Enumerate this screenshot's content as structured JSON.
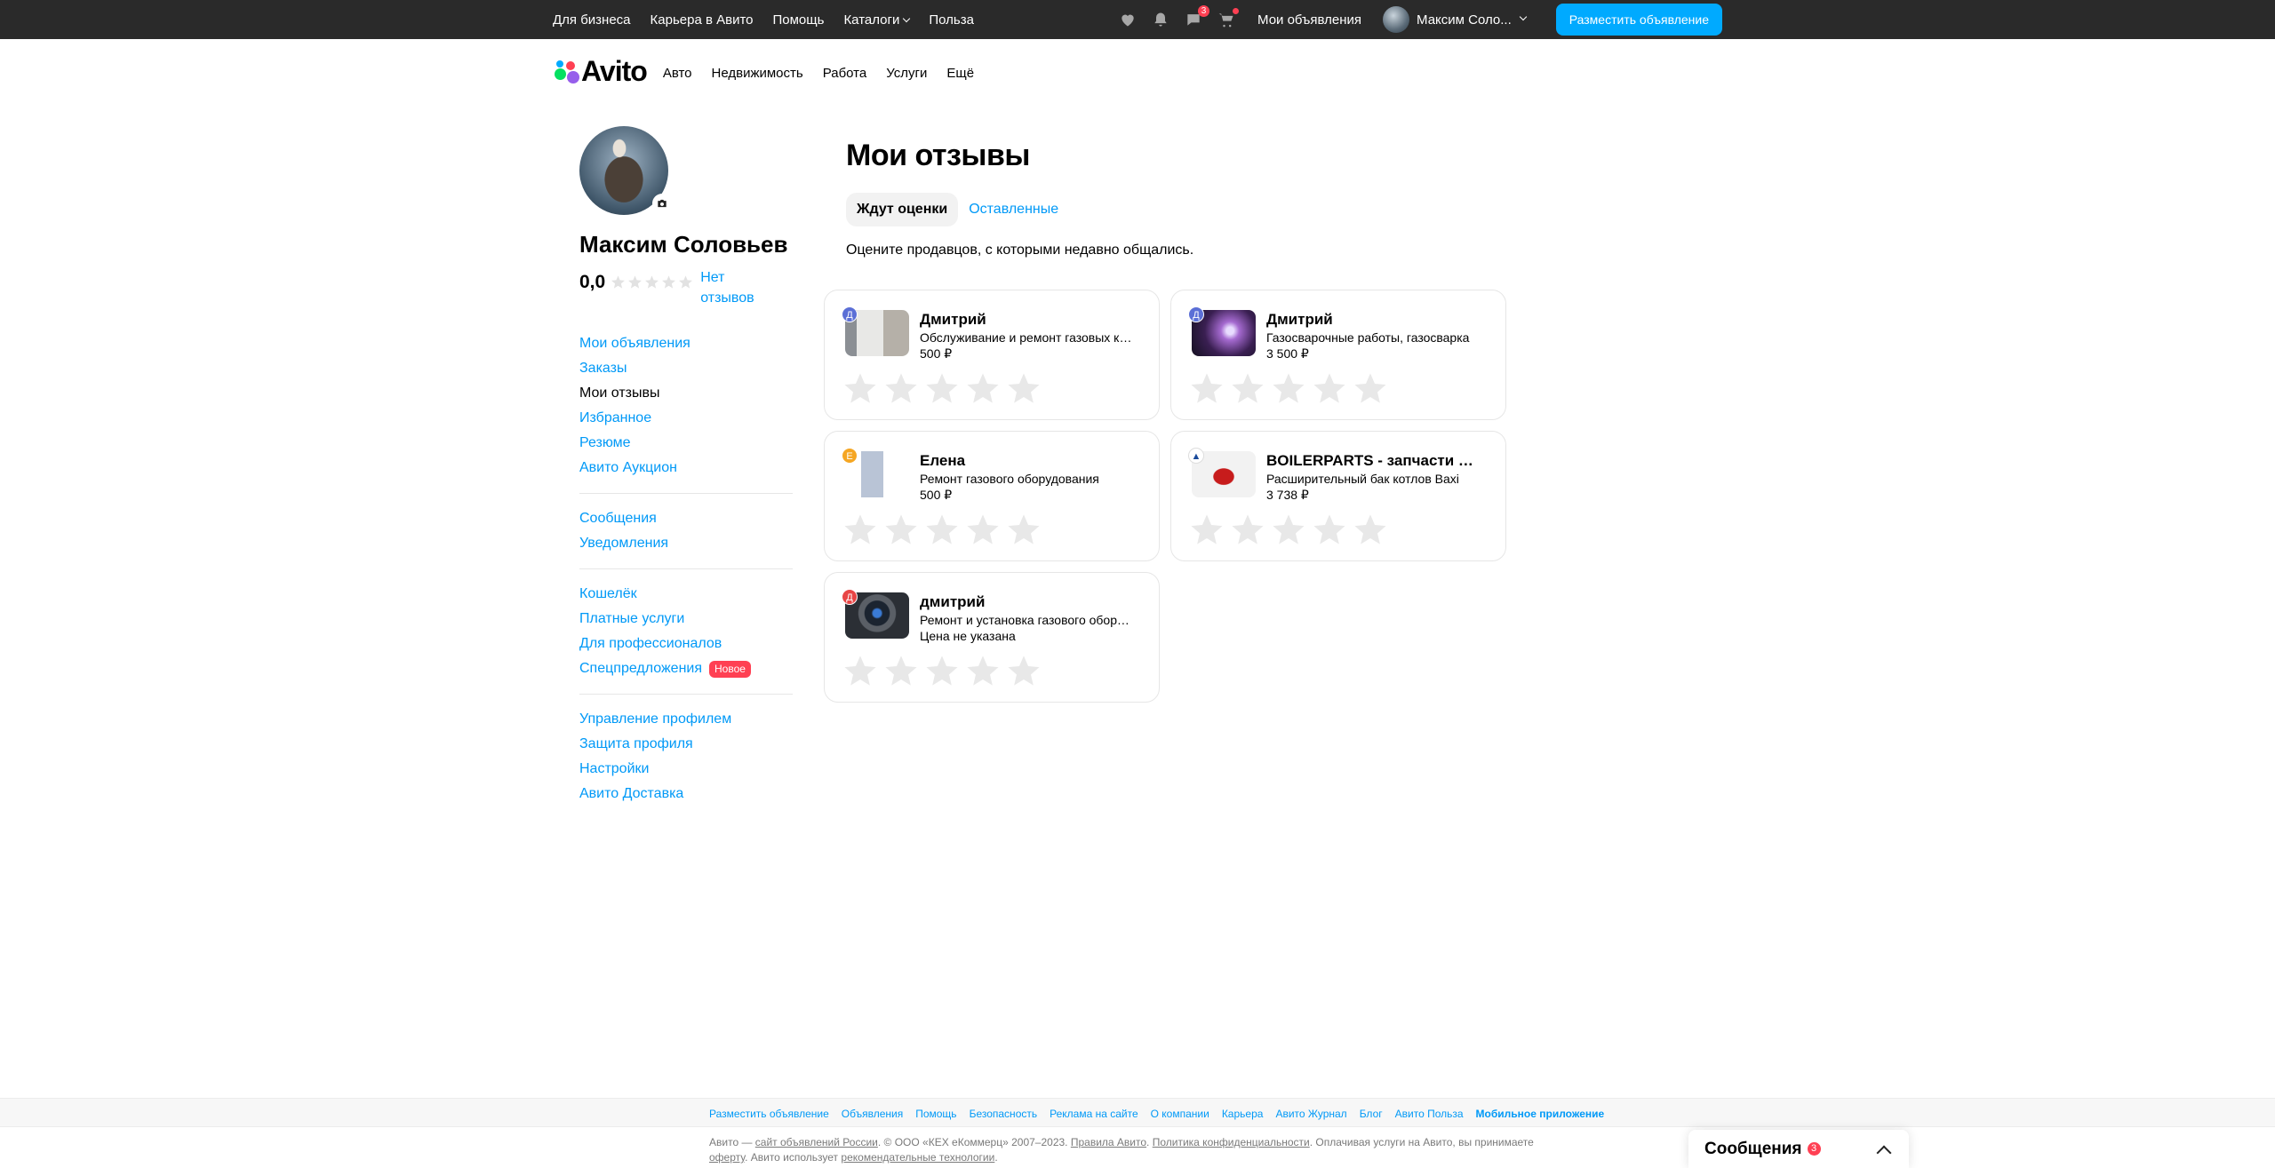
{
  "topbar": {
    "links": [
      "Для бизнеса",
      "Карьера в Авито",
      "Помощь",
      "Каталоги",
      "Польза"
    ],
    "messages_badge": "3",
    "my_ads": "Мои объявления",
    "user_name": "Максим Соло...",
    "post_button": "Разместить объявление"
  },
  "header": {
    "logo": "Avito",
    "nav": [
      "Авто",
      "Недвижимость",
      "Работа",
      "Услуги",
      "Ещё"
    ]
  },
  "profile": {
    "name": "Максим Соловьев",
    "rating": "0,0",
    "no_reviews": "Нет отзывов"
  },
  "sidebar": {
    "group1": [
      "Мои объявления",
      "Заказы",
      "Мои отзывы",
      "Избранное",
      "Резюме",
      "Авито Аукцион"
    ],
    "group2": [
      "Сообщения",
      "Уведомления"
    ],
    "group3": [
      "Кошелёк",
      "Платные услуги",
      "Для профессионалов",
      "Спецпредложения"
    ],
    "new_badge": "Новое",
    "group4": [
      "Управление профилем",
      "Защита профиля",
      "Настройки",
      "Авито Доставка"
    ]
  },
  "main": {
    "title": "Мои отзывы",
    "tab_waiting": "Ждут оценки",
    "tab_left": "Оставленные",
    "hint": "Оцените продавцов, с которыми недавно общались."
  },
  "cards": [
    {
      "letter": "Д",
      "letter_color": "#5b6fd6",
      "name": "Дмитрий",
      "desc": "Обслуживание и ремонт газовых котлов",
      "price": "500 ₽"
    },
    {
      "letter": "Д",
      "letter_color": "#5b6fd6",
      "name": "Дмитрий",
      "desc": "Газосварочные работы, газосварка",
      "price": "3 500 ₽"
    },
    {
      "letter": "Е",
      "letter_color": "#f5a623",
      "name": "Елена",
      "desc": "Ремонт газового оборудования",
      "price": "500 ₽"
    },
    {
      "letter": "",
      "letter_color": "#ffffff",
      "name": "BOILERPARTS - запчасти для котлов",
      "desc": "Расширительный бак котлов Baxi",
      "price": "3 738 ₽"
    },
    {
      "letter": "Д",
      "letter_color": "#e84545",
      "name": "дмитрий",
      "desc": "Ремонт и установка газового оборудования",
      "price": "Цена не указана"
    }
  ],
  "footer": {
    "links": [
      "Разместить объявление",
      "Объявления",
      "Помощь",
      "Безопасность",
      "Реклама на сайте",
      "О компании",
      "Карьера",
      "Авито Журнал",
      "Блог",
      "Авито Польза",
      "Мобильное приложение"
    ],
    "legal_1": "Авито —",
    "legal_site": "сайт объявлений России",
    "legal_2": ". © ООО «КЕХ еКоммерц» 2007–2023.",
    "legal_rules": "Правила Авито",
    "legal_policy": "Политика конфиденциальности",
    "legal_3": ". Оплачивая услуги на Авито, вы принимаете",
    "legal_offer": "оферту",
    "legal_4": ". Авито использует",
    "legal_tech": "рекомендательные технологии",
    "legal_5": "."
  },
  "messenger": {
    "title": "Сообщения",
    "badge": "3"
  }
}
